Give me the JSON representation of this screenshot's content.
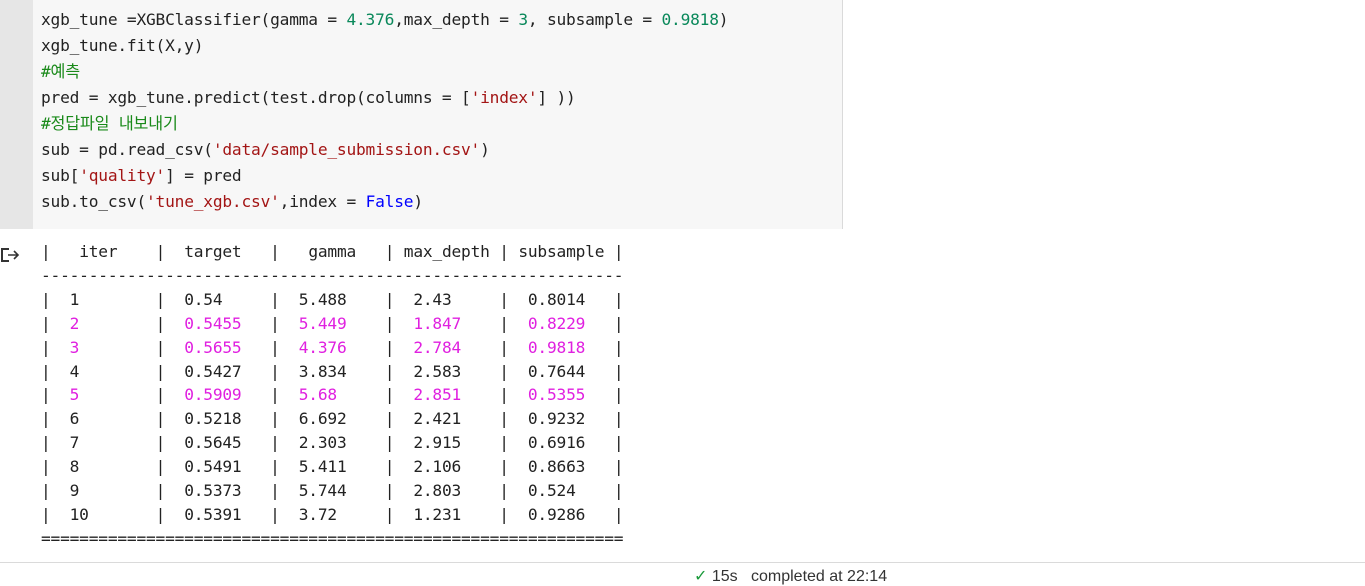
{
  "code": {
    "lines": [
      [
        [
          "xgb_tune =XGBClassifier(gamma = ",
          ""
        ],
        [
          "4.376",
          "num"
        ],
        [
          ",max_depth = ",
          ""
        ],
        [
          "3",
          "num"
        ],
        [
          ", subsample = ",
          ""
        ],
        [
          "0.9818",
          "num"
        ],
        [
          ")",
          ""
        ]
      ],
      [
        [
          "xgb_tune.fit(X,y)",
          ""
        ]
      ],
      [
        [
          "#예측",
          "cm"
        ]
      ],
      [
        [
          "pred = xgb_tune.predict(test.drop(columns = [",
          ""
        ],
        [
          "'index'",
          "str"
        ],
        [
          "] ))",
          ""
        ]
      ],
      [
        [
          "#정답파일 내보내기",
          "cm"
        ]
      ],
      [
        [
          "sub = pd.read_csv(",
          ""
        ],
        [
          "'data/sample_submission.csv'",
          "str"
        ],
        [
          ")",
          ""
        ]
      ],
      [
        [
          "sub[",
          ""
        ],
        [
          "'quality'",
          "str"
        ],
        [
          "] = pred",
          ""
        ]
      ],
      [
        [
          "sub.to_csv(",
          ""
        ],
        [
          "'tune_xgb.csv'",
          "str"
        ],
        [
          ",index = ",
          ""
        ],
        [
          "False",
          "kw"
        ],
        [
          ")",
          ""
        ]
      ]
    ]
  },
  "output": {
    "headers": [
      "iter",
      "target",
      "gamma",
      "max_depth",
      "subsample"
    ],
    "rows": [
      {
        "cells": [
          "1",
          "0.54",
          "5.488",
          "2.43",
          "0.8014"
        ],
        "highlight": false
      },
      {
        "cells": [
          "2",
          "0.5455",
          "5.449",
          "1.847",
          "0.8229"
        ],
        "highlight": true
      },
      {
        "cells": [
          "3",
          "0.5655",
          "4.376",
          "2.784",
          "0.9818"
        ],
        "highlight": true
      },
      {
        "cells": [
          "4",
          "0.5427",
          "3.834",
          "2.583",
          "0.7644"
        ],
        "highlight": false
      },
      {
        "cells": [
          "5",
          "0.5909",
          "5.68",
          "2.851",
          "0.5355"
        ],
        "highlight": true
      },
      {
        "cells": [
          "6",
          "0.5218",
          "6.692",
          "2.421",
          "0.9232"
        ],
        "highlight": false
      },
      {
        "cells": [
          "7",
          "0.5645",
          "2.303",
          "2.915",
          "0.6916"
        ],
        "highlight": false
      },
      {
        "cells": [
          "8",
          "0.5491",
          "5.411",
          "2.106",
          "0.8663"
        ],
        "highlight": false
      },
      {
        "cells": [
          "9",
          "0.5373",
          "5.744",
          "2.803",
          "0.524"
        ],
        "highlight": false
      },
      {
        "cells": [
          "10",
          "0.5391",
          "3.72",
          "1.231",
          "0.9286"
        ],
        "highlight": false
      }
    ],
    "highlight_color": "#e020e0"
  },
  "status": {
    "check_icon": "check-icon",
    "text": "15s   completed at 22:14"
  }
}
